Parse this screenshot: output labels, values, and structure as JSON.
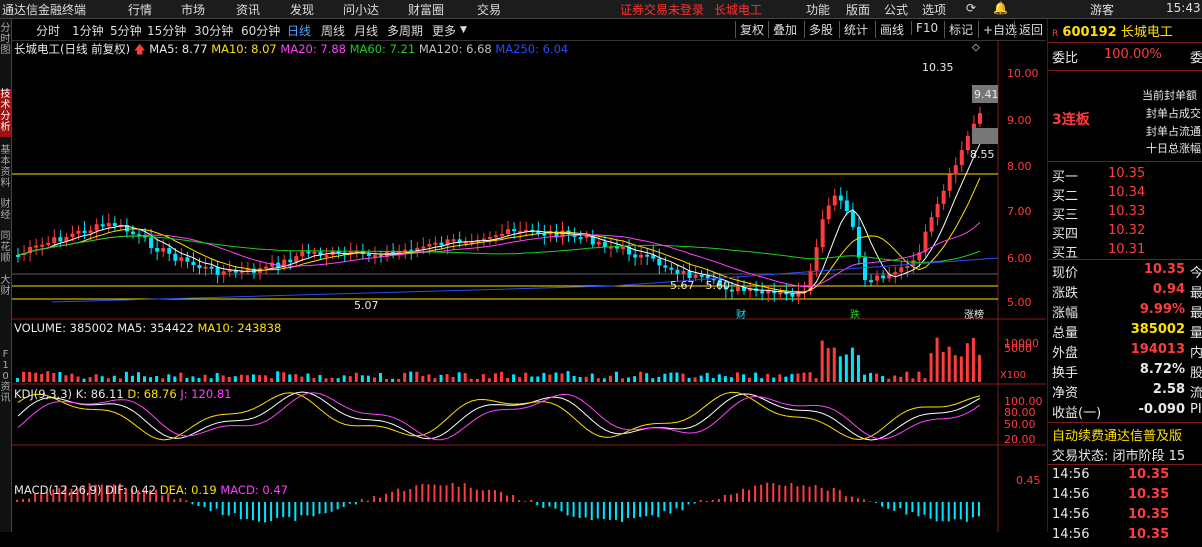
{
  "menubar": {
    "app_title": "通达信金融终端",
    "menus": [
      "行情",
      "市场",
      "资讯",
      "发现",
      "问小达",
      "财富圈",
      "交易"
    ],
    "warning": "证券交易未登录",
    "stock_short": "长城电工",
    "right_menus": [
      "功能",
      "版面",
      "公式",
      "选项"
    ],
    "guest": "游客",
    "clock": "15:43"
  },
  "periods": [
    "分时",
    "1分钟",
    "5分钟",
    "15分钟",
    "30分钟",
    "60分钟",
    "日线",
    "周线",
    "月线",
    "多周期",
    "更多"
  ],
  "active_period": "日线",
  "tools": [
    "复权",
    "叠加",
    "多股",
    "统计",
    "画线",
    "F10",
    "标记",
    "+自选",
    "返回"
  ],
  "left_tabs": [
    "分时图",
    "技术分析",
    "基本资料",
    "财经",
    "同花顺",
    "大财",
    "F10资讯"
  ],
  "price_legend": {
    "name": "长城电工(日线 前复权)",
    "ma5": "MA5: 8.77",
    "ma10": "MA10: 8.07",
    "ma20": "MA20: 7.88",
    "ma60": "MA60: 7.21",
    "ma120": "MA120: 6.68",
    "ma250": "MA250: 6.04"
  },
  "price_labels": {
    "high": "10.35",
    "last_box": "9.41",
    "prev_box": "8.55",
    "low_left": "5.07",
    "mid_range": "5.67 - 5.60",
    "tag_cai": "财",
    "tag_die": "跌",
    "tag_zhang": "涨榜"
  },
  "volume_legend": {
    "vol": "VOLUME: 385002",
    "ma5": "MA5: 354422",
    "ma10": "MA10: 243838",
    "unit": "X100"
  },
  "kdj_legend": {
    "name": "KDJ(9,3,3)",
    "k": "K: 86.11",
    "d": "D: 68.76",
    "j": "J: 120.81"
  },
  "macd_legend": {
    "name": "MACD(12,26,9)",
    "dif": "DIF: 0.42",
    "dea": "DEA: 0.19",
    "macd": "MACD: 0.47"
  },
  "axes": {
    "price_ticks": [
      "10.00",
      "9.00",
      "8.00",
      "7.00",
      "6.00",
      "5.00"
    ],
    "volume_ticks": [
      "10000",
      "5000"
    ],
    "kdj_ticks": [
      "100.00",
      "80.00",
      "50.00",
      "20.00"
    ],
    "macd_ticks": [
      "0.45"
    ]
  },
  "right_panel": {
    "code": "600192",
    "name": "长城电工",
    "weibi_label": "委比",
    "weibi_value": "100.00%",
    "weicha_label": "委",
    "limit_label": "3连板",
    "limit_lines": [
      "当前封单额",
      "封单占成交",
      "封单占流通",
      "十日总涨幅"
    ],
    "bids": [
      {
        "label": "买一",
        "price": "10.35"
      },
      {
        "label": "买二",
        "price": "10.34"
      },
      {
        "label": "买三",
        "price": "10.33"
      },
      {
        "label": "买四",
        "price": "10.32"
      },
      {
        "label": "买五",
        "price": "10.31"
      }
    ],
    "stats": [
      {
        "label": "现价",
        "value": "10.35",
        "tail": "今"
      },
      {
        "label": "涨跌",
        "value": "0.94",
        "tail": "最"
      },
      {
        "label": "涨幅",
        "value": "9.99%",
        "tail": "最"
      },
      {
        "label": "总量",
        "value": "385002",
        "tail": "量"
      },
      {
        "label": "外盘",
        "value": "194013",
        "tail": "内"
      },
      {
        "label": "换手",
        "value": "8.72%",
        "tail": "股"
      },
      {
        "label": "净资",
        "value": "2.58",
        "tail": "流"
      },
      {
        "label": "收益(一)",
        "value": "-0.090",
        "tail": "PI"
      }
    ],
    "scroll_text": "自动续费通达信普及版",
    "status": "交易状态: 闭市阶段",
    "status_tail": "15",
    "ticks": [
      {
        "time": "14:56",
        "price": "10.35"
      },
      {
        "time": "14:56",
        "price": "10.35"
      },
      {
        "time": "14:56",
        "price": "10.35"
      },
      {
        "time": "14:56",
        "price": "10.35"
      }
    ]
  },
  "colors": {
    "up": "#ff3c3c",
    "down": "#00e5ff",
    "ma5": "#ffffff",
    "ma10": "#ffe000",
    "ma20": "#ff40ff",
    "ma60": "#19d219",
    "ma120": "#c0c0c0",
    "ma250": "#2a4cff",
    "active": "#4fa3ff"
  }
}
